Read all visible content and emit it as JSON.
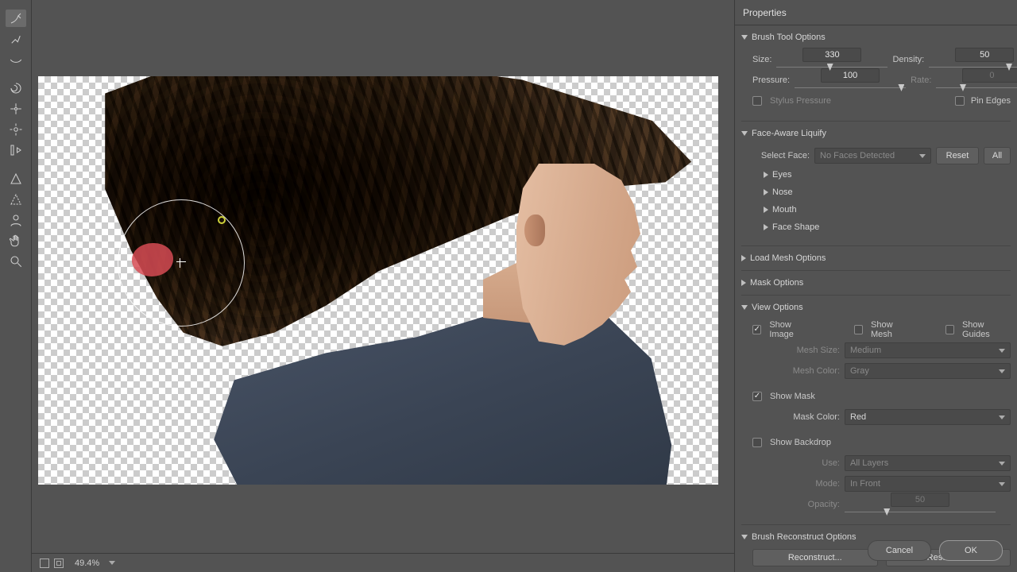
{
  "panel_title": "Properties",
  "zoom": "49.4%",
  "tools": [
    "forward-warp",
    "reconstruct",
    "smooth",
    "twirl",
    "pucker",
    "bloat",
    "push-left",
    "freeze-mask",
    "thaw-mask",
    "face",
    "hand",
    "zoom"
  ],
  "brush_opts": {
    "title": "Brush Tool Options",
    "size_label": "Size:",
    "size_value": "330",
    "density_label": "Density:",
    "density_value": "50",
    "pressure_label": "Pressure:",
    "pressure_value": "100",
    "rate_label": "Rate:",
    "rate_value": "0",
    "stylus_label": "Stylus Pressure",
    "pin_label": "Pin Edges"
  },
  "face": {
    "title": "Face-Aware Liquify",
    "select_label": "Select Face:",
    "select_value": "No Faces Detected",
    "reset": "Reset",
    "all": "All",
    "eyes": "Eyes",
    "nose": "Nose",
    "mouth": "Mouth",
    "shape": "Face Shape"
  },
  "load_mesh": {
    "title": "Load Mesh Options"
  },
  "mask_opts": {
    "title": "Mask Options"
  },
  "view": {
    "title": "View Options",
    "show_image": "Show Image",
    "show_mesh": "Show Mesh",
    "show_guides": "Show Guides",
    "mesh_size_label": "Mesh Size:",
    "mesh_size_value": "Medium",
    "mesh_color_label": "Mesh Color:",
    "mesh_color_value": "Gray",
    "show_mask": "Show Mask",
    "mask_color_label": "Mask Color:",
    "mask_color_value": "Red",
    "show_backdrop": "Show Backdrop",
    "use_label": "Use:",
    "use_value": "All Layers",
    "mode_label": "Mode:",
    "mode_value": "In Front",
    "opacity_label": "Opacity:",
    "opacity_value": "50"
  },
  "reconstruct": {
    "title": "Brush Reconstruct Options",
    "reconstruct_btn": "Reconstruct...",
    "restore_btn": "Restore All"
  },
  "footer": {
    "cancel": "Cancel",
    "ok": "OK"
  },
  "slider_pos": {
    "size": "48%",
    "density": "72%",
    "pressure": "96%",
    "rate": "24%",
    "opacity": "28%"
  }
}
